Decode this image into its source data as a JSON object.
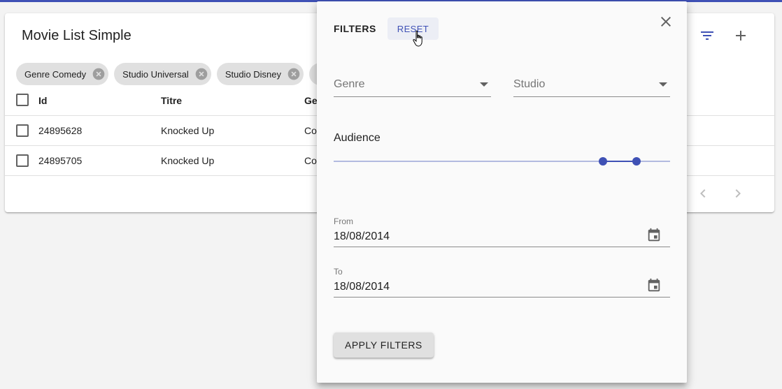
{
  "card": {
    "title": "Movie List Simple"
  },
  "chips": [
    {
      "label": "Genre Comedy"
    },
    {
      "label": "Studio Universal"
    },
    {
      "label": "Studio Disney"
    }
  ],
  "table": {
    "headers": {
      "id": "Id",
      "titre": "Titre",
      "genre": "Ge"
    },
    "rows": [
      {
        "id": "24895628",
        "titre": "Knocked Up",
        "genre": "Co"
      },
      {
        "id": "24895705",
        "titre": "Knocked Up",
        "genre": "Co"
      }
    ]
  },
  "filters": {
    "title": "FILTERS",
    "reset_label": "RESET",
    "genre_placeholder": "Genre",
    "studio_placeholder": "Studio",
    "audience_label": "Audience",
    "audience_range": {
      "low_fraction": 0.8,
      "high_fraction": 0.9
    },
    "from_label": "From",
    "from_value": "18/08/2014",
    "to_label": "To",
    "to_value": "18/08/2014",
    "apply_label": "APPLY FILTERS"
  },
  "colors": {
    "primary": "#3f51b5",
    "chip_bg": "#e0e0e0",
    "panel_bg": "#fafafa"
  },
  "icons": [
    "filter-icon",
    "add-icon",
    "close-icon",
    "cancel-circle-icon",
    "calendar-icon",
    "chevron-left-icon",
    "chevron-right-icon",
    "hand-cursor-icon"
  ]
}
